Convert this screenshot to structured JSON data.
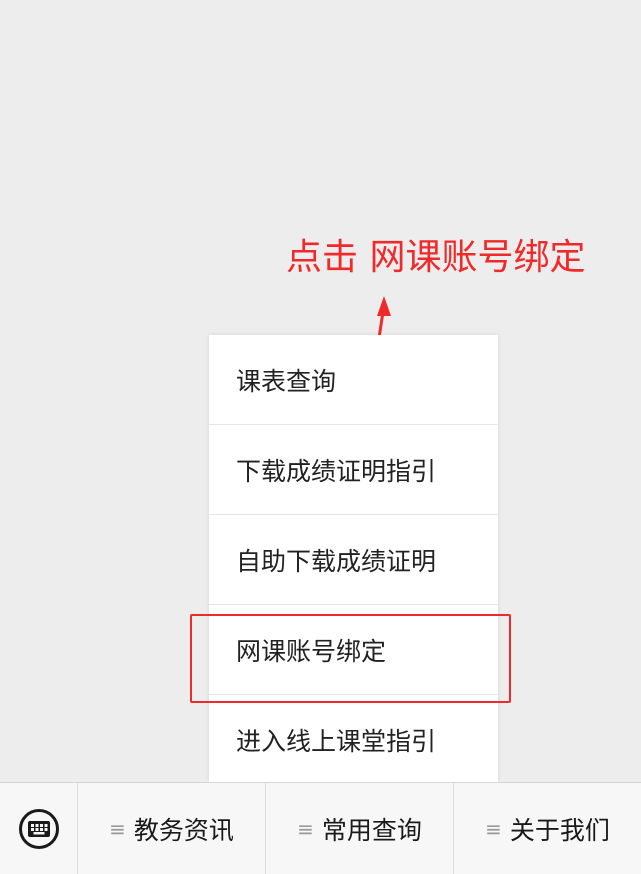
{
  "annotation": {
    "text": "点击 网课账号绑定",
    "color": "#f02a2a"
  },
  "menu": {
    "items": [
      {
        "label": "课表查询"
      },
      {
        "label": "下载成绩证明指引"
      },
      {
        "label": "自助下载成绩证明"
      },
      {
        "label": "网课账号绑定"
      },
      {
        "label": "进入线上课堂指引"
      }
    ]
  },
  "bottom_bar": {
    "keyboard_icon": "keyboard-icon",
    "tabs": [
      {
        "icon": "≡",
        "label": "教务资讯"
      },
      {
        "icon": "≡",
        "label": "常用查询"
      },
      {
        "icon": "≡",
        "label": "关于我们"
      }
    ]
  }
}
